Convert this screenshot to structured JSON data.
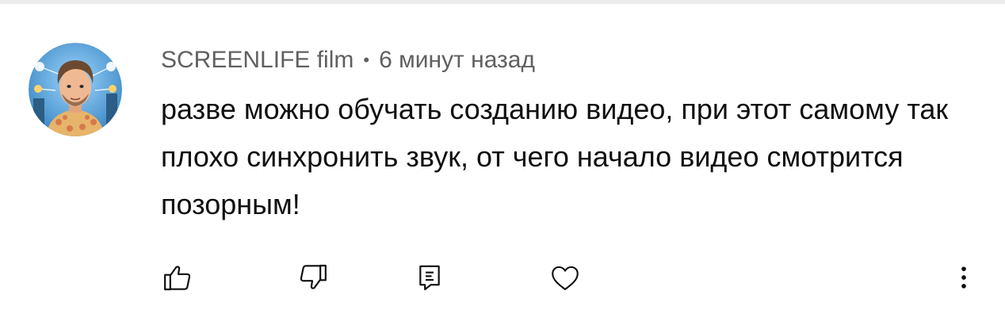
{
  "comment": {
    "author": "SCREENLIFE film",
    "separator": "•",
    "time": "6 минут назад",
    "text": "разве можно обучать созданию видео, при этот самому так плохо синхронить звук, от чего начало видео смотрится позорным!"
  },
  "actions": {
    "like_icon": "thumbs-up-icon",
    "dislike_icon": "thumbs-down-icon",
    "reply_icon": "reply-comment-icon",
    "heart_icon": "heart-icon",
    "more_icon": "more-vertical-icon"
  }
}
